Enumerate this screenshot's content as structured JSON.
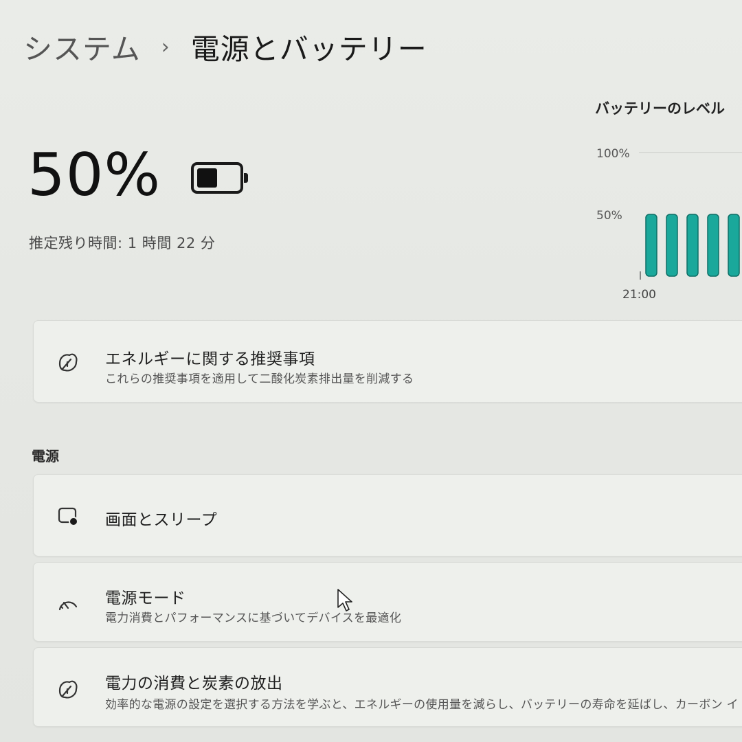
{
  "breadcrumb": {
    "parent": "システム",
    "separator": "›",
    "current": "電源とバッテリー"
  },
  "battery": {
    "percent_label": "50%",
    "level": 0.5,
    "remaining": "推定残り時間: 1 時間 22 分"
  },
  "chart_data": {
    "type": "bar",
    "title": "バッテリーのレベル",
    "ytick_labels": [
      "100%",
      "50%"
    ],
    "ylim": [
      0,
      100
    ],
    "x_start_label": "21:00",
    "values": [
      50,
      50,
      50,
      50,
      50
    ],
    "bar_color": "#1aa89b"
  },
  "recommendations": {
    "title": "エネルギーに関する推奨事項",
    "description": "これらの推奨事項を適用して二酸化炭素排出量を削減する",
    "icon": "leaf-icon"
  },
  "power_section": {
    "label": "電源",
    "items": [
      {
        "title": "画面とスリープ",
        "description": "",
        "icon": "screen-sleep-icon"
      },
      {
        "title": "電源モード",
        "description": "電力消費とパフォーマンスに基づいてデバイスを最適化",
        "icon": "gauge-icon"
      },
      {
        "title": "電力の消費と炭素の放出",
        "description": "効率的な電源の設定を選択する方法を学ぶと、エネルギーの使用量を減らし、バッテリーの寿命を延ばし、カーボン イ",
        "icon": "leaf-icon"
      }
    ]
  }
}
